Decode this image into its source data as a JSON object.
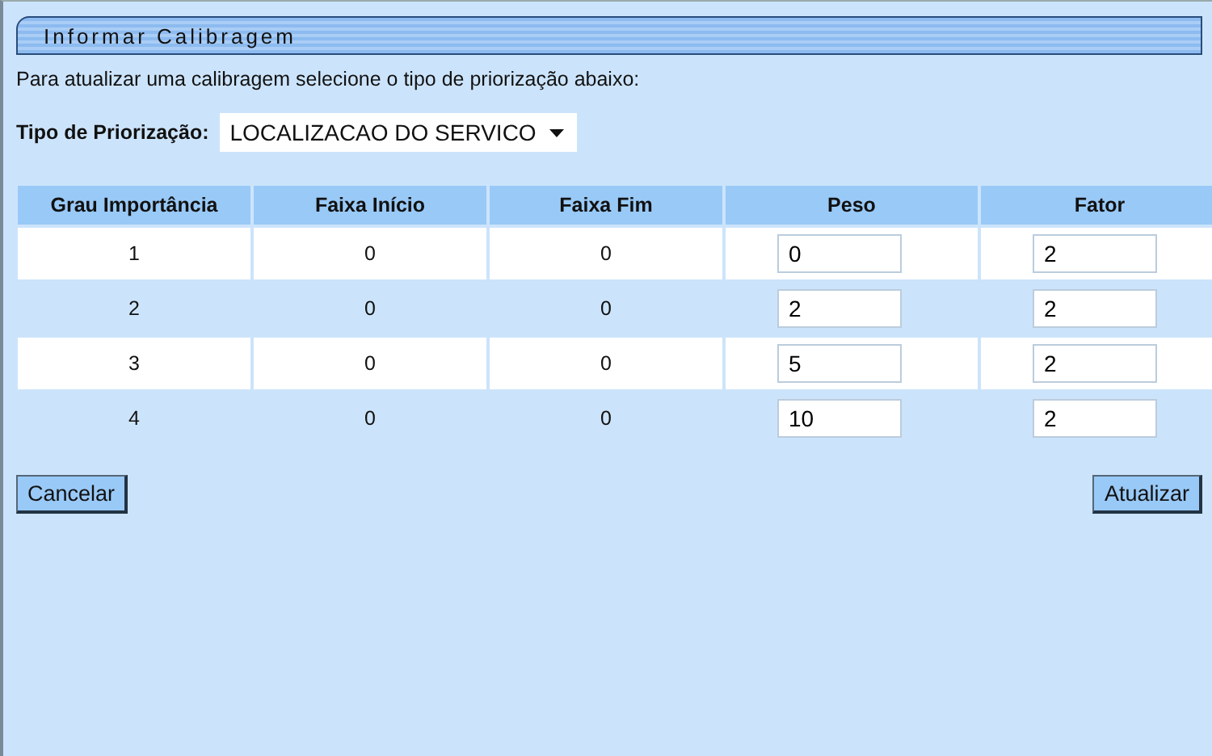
{
  "window": {
    "title": "Informar Calibragem"
  },
  "instruction": "Para atualizar uma calibragem selecione o tipo de priorização abaixo:",
  "priority_type": {
    "label": "Tipo de Priorização:",
    "value": "LOCALIZACAO DO SERVICO"
  },
  "table": {
    "columns": [
      "Grau Importância",
      "Faixa Início",
      "Faixa Fim",
      "Peso",
      "Fator"
    ],
    "rows": [
      {
        "grau": "1",
        "faixa_inicio": "0",
        "faixa_fim": "0",
        "peso": "0",
        "fator": "2"
      },
      {
        "grau": "2",
        "faixa_inicio": "0",
        "faixa_fim": "0",
        "peso": "2",
        "fator": "2"
      },
      {
        "grau": "3",
        "faixa_inicio": "0",
        "faixa_fim": "0",
        "peso": "5",
        "fator": "2"
      },
      {
        "grau": "4",
        "faixa_inicio": "0",
        "faixa_fim": "0",
        "peso": "10",
        "fator": "2"
      }
    ]
  },
  "buttons": [
    "Cancelar",
    "Atualizar"
  ]
}
